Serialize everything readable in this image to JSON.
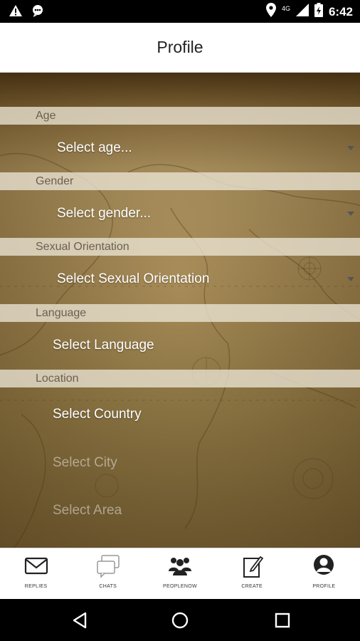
{
  "status_bar": {
    "network_label": "4G",
    "time": "6:42",
    "icons": [
      "warning-icon",
      "notification-icon",
      "location-icon",
      "signal-icon",
      "battery-icon"
    ]
  },
  "app_bar": {
    "title": "Profile"
  },
  "form": {
    "age": {
      "header": "Age",
      "value": "Select age..."
    },
    "gender": {
      "header": "Gender",
      "value": "Select gender..."
    },
    "orientation": {
      "header": "Sexual Orientation",
      "value": "Select Sexual Orientation"
    },
    "language": {
      "header": "Language",
      "value": "Select Language"
    },
    "location": {
      "header": "Location",
      "country": "Select Country",
      "city": "Select City",
      "area": "Select Area"
    }
  },
  "bottom_nav": {
    "items": [
      {
        "label": "REPLIES",
        "icon": "envelope-icon"
      },
      {
        "label": "CHATS",
        "icon": "chat-bubbles-icon"
      },
      {
        "label": "PEOPLENOW",
        "icon": "people-group-icon"
      },
      {
        "label": "CREATE",
        "icon": "edit-icon"
      },
      {
        "label": "PROFILE",
        "icon": "person-icon"
      }
    ]
  },
  "system_nav": {
    "buttons": [
      "back-icon",
      "home-icon",
      "recents-icon"
    ]
  }
}
